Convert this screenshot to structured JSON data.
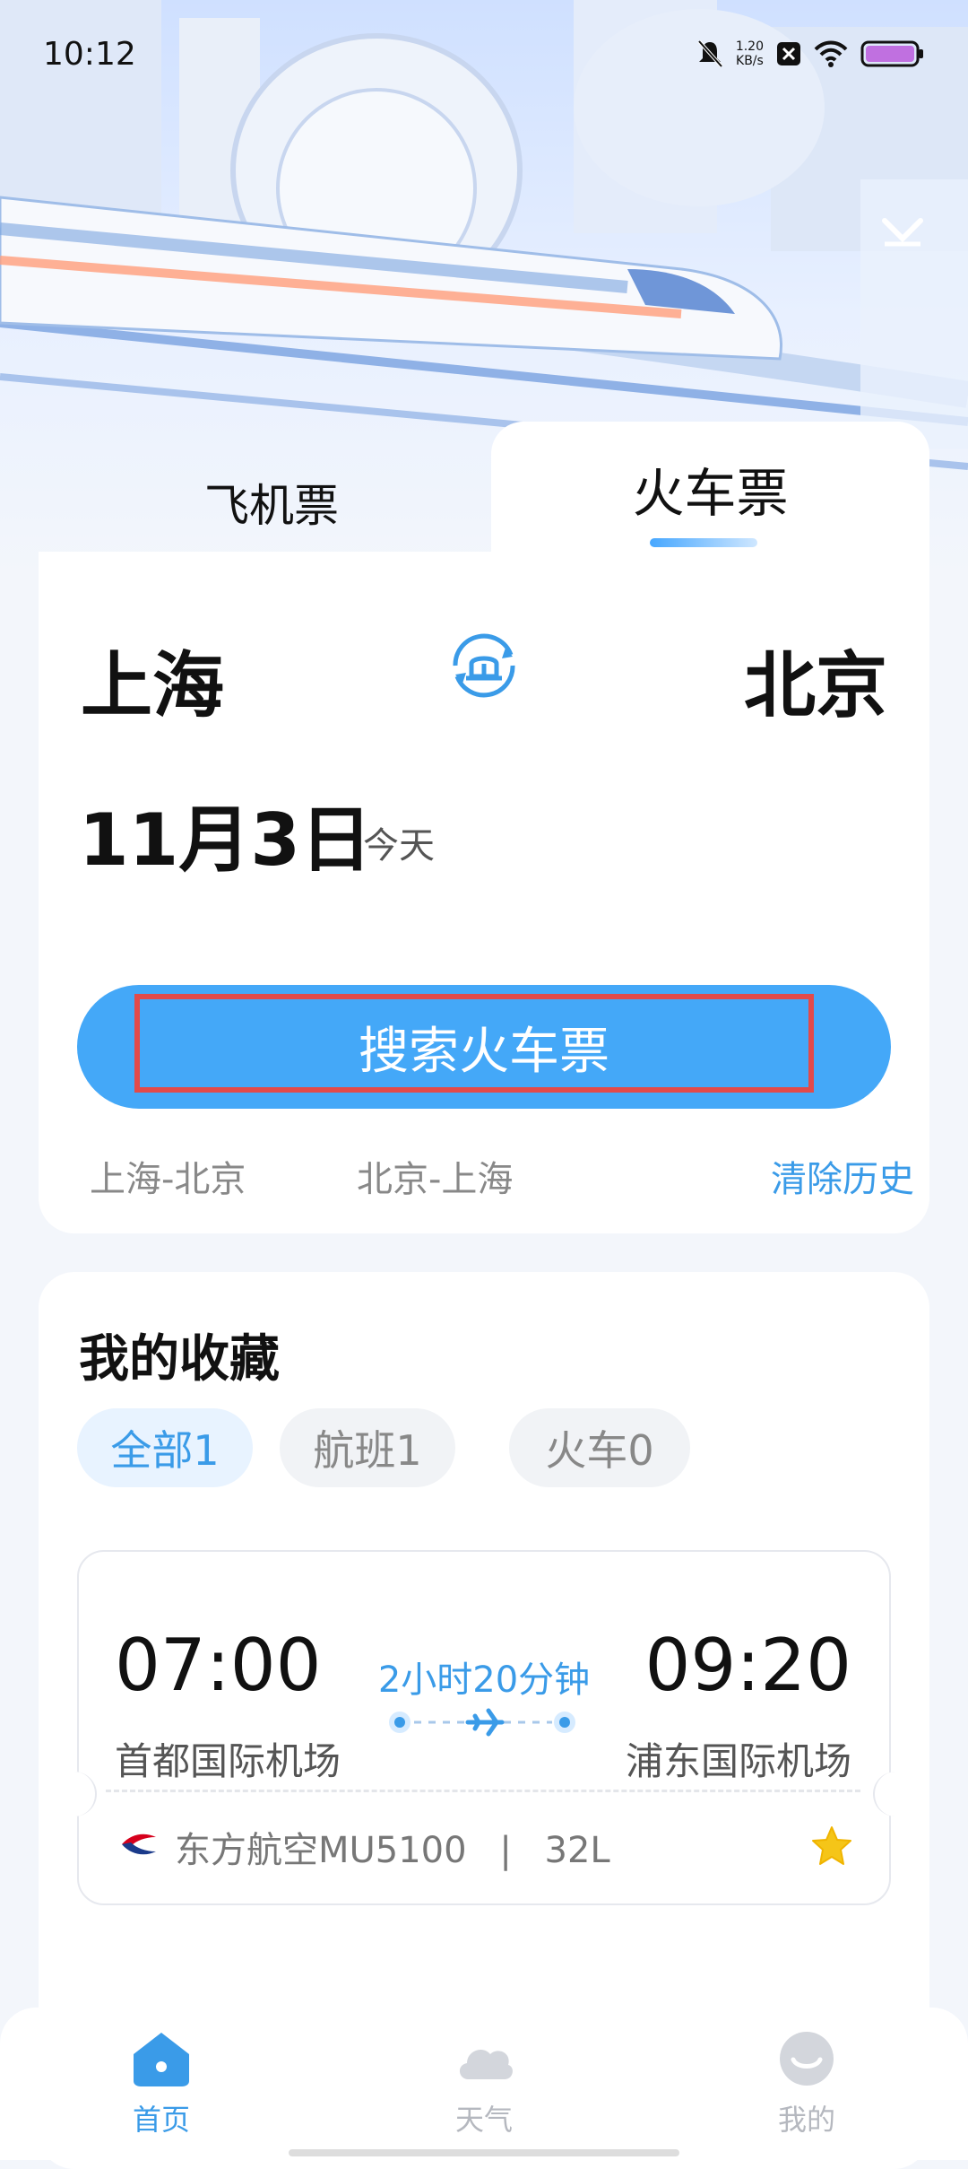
{
  "status_bar": {
    "time": "10:12",
    "net_speed_value": "1.20",
    "net_speed_unit": "KB/s"
  },
  "tabs": {
    "plane": "飞机票",
    "train": "火车票",
    "active": "train"
  },
  "search": {
    "from_city": "上海",
    "to_city": "北京",
    "date": "11月3日",
    "date_note": "今天",
    "button_label": "搜索火车票",
    "history": [
      "上海-北京",
      "北京-上海"
    ],
    "clear_history": "清除历史"
  },
  "favorites": {
    "title": "我的收藏",
    "filters": [
      {
        "label": "全部1",
        "active": true
      },
      {
        "label": "航班1",
        "active": false
      },
      {
        "label": "火车0",
        "active": false
      }
    ],
    "items": [
      {
        "depart_time": "07:00",
        "arrive_time": "09:20",
        "duration": "2小时20分钟",
        "depart_airport": "首都国际机场",
        "arrive_airport": "浦东国际机场",
        "airline_flight": "东方航空MU5100",
        "separator": "|",
        "aircraft": "32L"
      }
    ]
  },
  "bottom_nav": [
    {
      "label": "首页",
      "icon": "home-icon",
      "active": true
    },
    {
      "label": "天气",
      "icon": "cloud-icon",
      "active": false
    },
    {
      "label": "我的",
      "icon": "profile-icon",
      "active": false
    }
  ],
  "colors": {
    "accent": "#44a8f8",
    "highlight_border": "#e24a4a",
    "star": "#f5c518"
  }
}
